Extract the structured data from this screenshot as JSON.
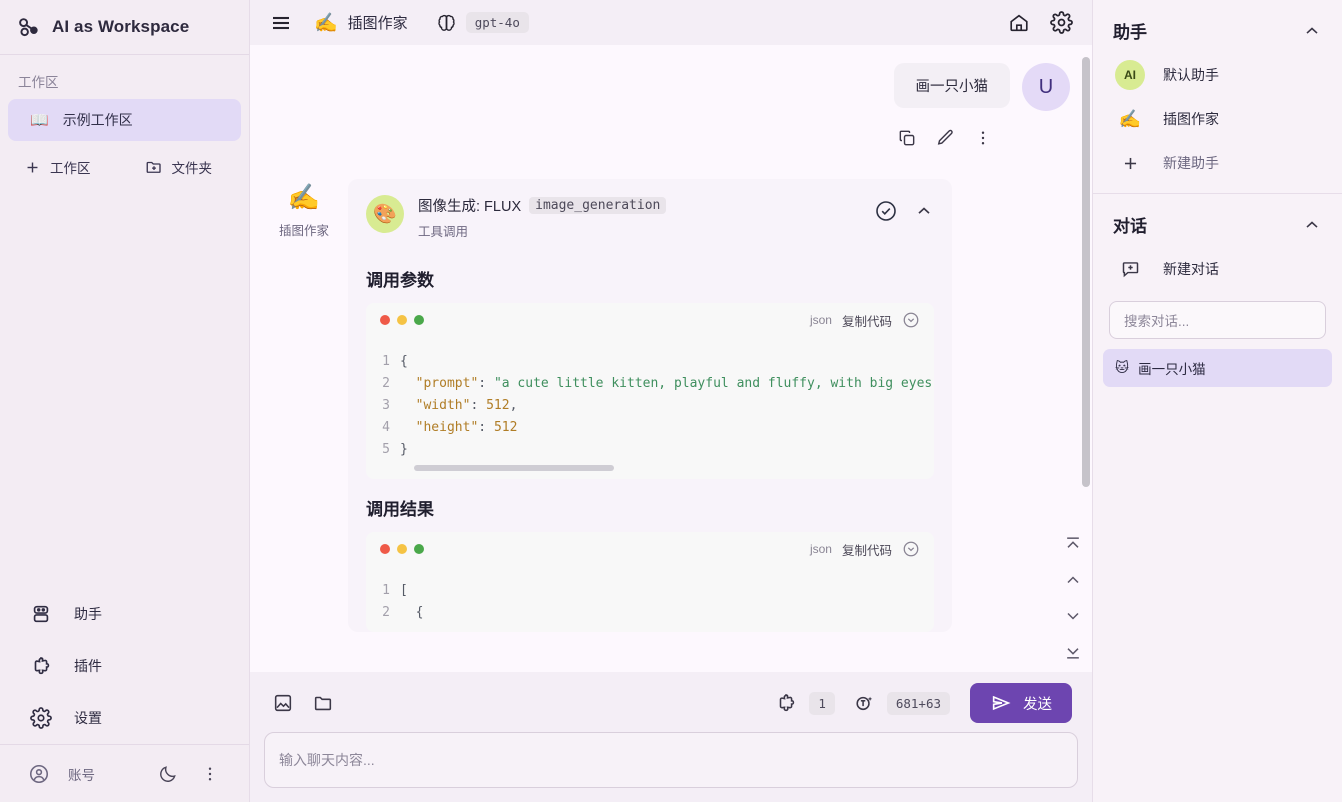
{
  "app": {
    "brand": "AI as Workspace"
  },
  "left_sidebar": {
    "workspace_label": "工作区",
    "workspace_items": [
      {
        "icon": "book-icon",
        "label": "示例工作区",
        "active": true
      }
    ],
    "actions": [
      {
        "icon": "plus-icon",
        "label": "工作区"
      },
      {
        "icon": "folder-plus-icon",
        "label": "文件夹"
      }
    ],
    "nav": [
      {
        "icon": "robot-icon",
        "label": "助手"
      },
      {
        "icon": "puzzle-icon",
        "label": "插件"
      },
      {
        "icon": "gear-icon",
        "label": "设置"
      }
    ],
    "footer": {
      "account_label": "账号",
      "theme_icon": "moon-icon",
      "more_icon": "more-vertical-icon"
    }
  },
  "topbar": {
    "menu_icon": "hamburger-menu-icon",
    "assistant_emoji": "✍️",
    "assistant_name": "插图作家",
    "model_icon": "brain-icon",
    "model_name": "gpt-4o",
    "home_icon": "home-icon",
    "settings_icon": "gear-icon"
  },
  "chat": {
    "user_message": {
      "text": "画一只小猫",
      "avatar_letter": "U",
      "actions": [
        {
          "icon": "copy-icon",
          "name": "copy"
        },
        {
          "icon": "pencil-icon",
          "name": "edit"
        },
        {
          "icon": "more-vertical-icon",
          "name": "more"
        }
      ]
    },
    "assistant": {
      "emoji": "✍️",
      "name": "插图作家",
      "tool_avatar_emoji": "🎨",
      "tool_title": "图像生成: FLUX",
      "tool_function": "image_generation",
      "tool_subtitle": "工具调用",
      "status_icon": "check-circle-icon",
      "collapse_icon": "chevron-up-icon",
      "params_section_title": "调用参数",
      "params_code": {
        "lang": "json",
        "copy_label": "复制代码",
        "expand_icon": "chevron-down-circle-icon",
        "lines": [
          {
            "no": "1",
            "text": "{"
          },
          {
            "no": "2",
            "text": "  \"prompt\": \"a cute little kitten, playful and fluffy, with big eyes"
          },
          {
            "no": "3",
            "text": "  \"width\": 512,"
          },
          {
            "no": "4",
            "text": "  \"height\": 512"
          },
          {
            "no": "5",
            "text": "}"
          }
        ]
      },
      "result_section_title": "调用结果",
      "result_code": {
        "lang": "json",
        "copy_label": "复制代码",
        "expand_icon": "chevron-down-circle-icon",
        "lines": [
          {
            "no": "1",
            "text": "["
          },
          {
            "no": "2",
            "text": "  {"
          }
        ]
      }
    },
    "scroll_nav": [
      {
        "icon": "scroll-to-top-icon"
      },
      {
        "icon": "chevron-up-icon"
      },
      {
        "icon": "chevron-down-icon"
      },
      {
        "icon": "scroll-to-bottom-icon"
      }
    ]
  },
  "composer": {
    "image_icon": "image-icon",
    "folder_icon": "folder-icon",
    "plugin_icon": "puzzle-icon",
    "plugin_count": "1",
    "token_icon": "token-icon",
    "token_count": "681+63",
    "send_icon": "send-icon",
    "send_label": "发送",
    "input_placeholder": "输入聊天内容..."
  },
  "right_sidebar": {
    "assistants_section": {
      "title": "助手",
      "chevron": "chevron-up-icon",
      "items": [
        {
          "badge": "AI",
          "type": "badge",
          "label": "默认助手"
        },
        {
          "badge": "✍️",
          "type": "emoji",
          "label": "插图作家"
        }
      ],
      "add_label": "新建助手",
      "add_icon": "plus-icon"
    },
    "conversations_section": {
      "title": "对话",
      "chevron": "chevron-up-icon",
      "new_label": "新建对话",
      "new_icon": "message-plus-icon",
      "search_placeholder": "搜索对话...",
      "items": [
        {
          "emoji": "🐱",
          "label": "画一只小猫",
          "active": true
        }
      ]
    }
  },
  "colors": {
    "accent": "#6d45b0",
    "active_bg": "#e2daf6",
    "sidebar_bg": "#f3ecf3",
    "chat_bg": "#fdf8fe",
    "tool_avatar_bg": "#d8eb92"
  }
}
